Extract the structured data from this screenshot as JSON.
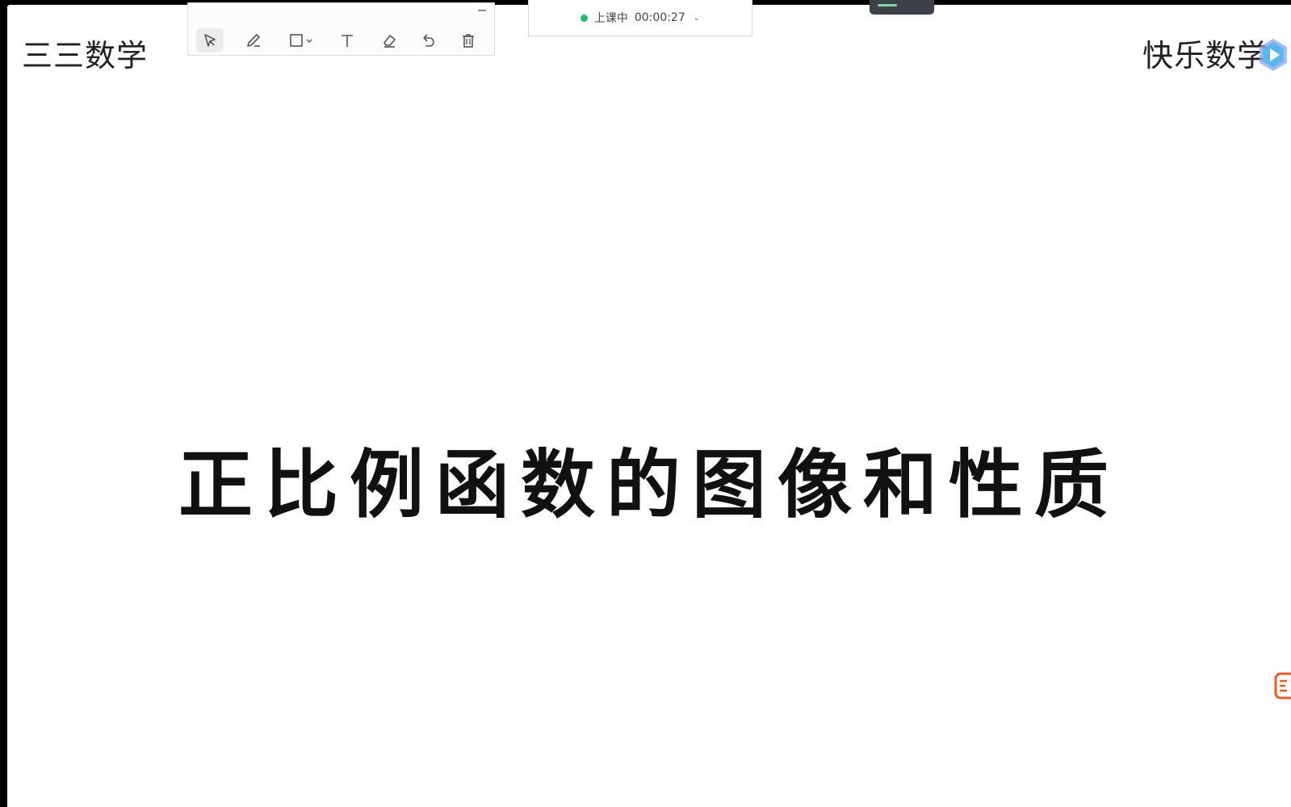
{
  "slide": {
    "brand_left": "三三数学",
    "brand_right": "快乐数学",
    "title": "正比例函数的图像和性质"
  },
  "toolbar": {
    "tools": [
      {
        "name": "select",
        "icon": "cursor-icon",
        "active": true
      },
      {
        "name": "pen",
        "icon": "pen-icon",
        "active": false
      },
      {
        "name": "shape",
        "icon": "rectangle-icon",
        "active": false
      },
      {
        "name": "text",
        "icon": "text-icon",
        "active": false
      },
      {
        "name": "eraser",
        "icon": "eraser-icon",
        "active": false
      },
      {
        "name": "undo",
        "icon": "undo-icon",
        "active": false
      },
      {
        "name": "delete",
        "icon": "trash-icon",
        "active": false
      }
    ]
  },
  "status": {
    "label": "上课中",
    "timer": "00:00:27",
    "dot_color": "#1fbf6a"
  },
  "colors": {
    "play_badge": "#5ab8f0",
    "side_badge": "#f05a22"
  }
}
